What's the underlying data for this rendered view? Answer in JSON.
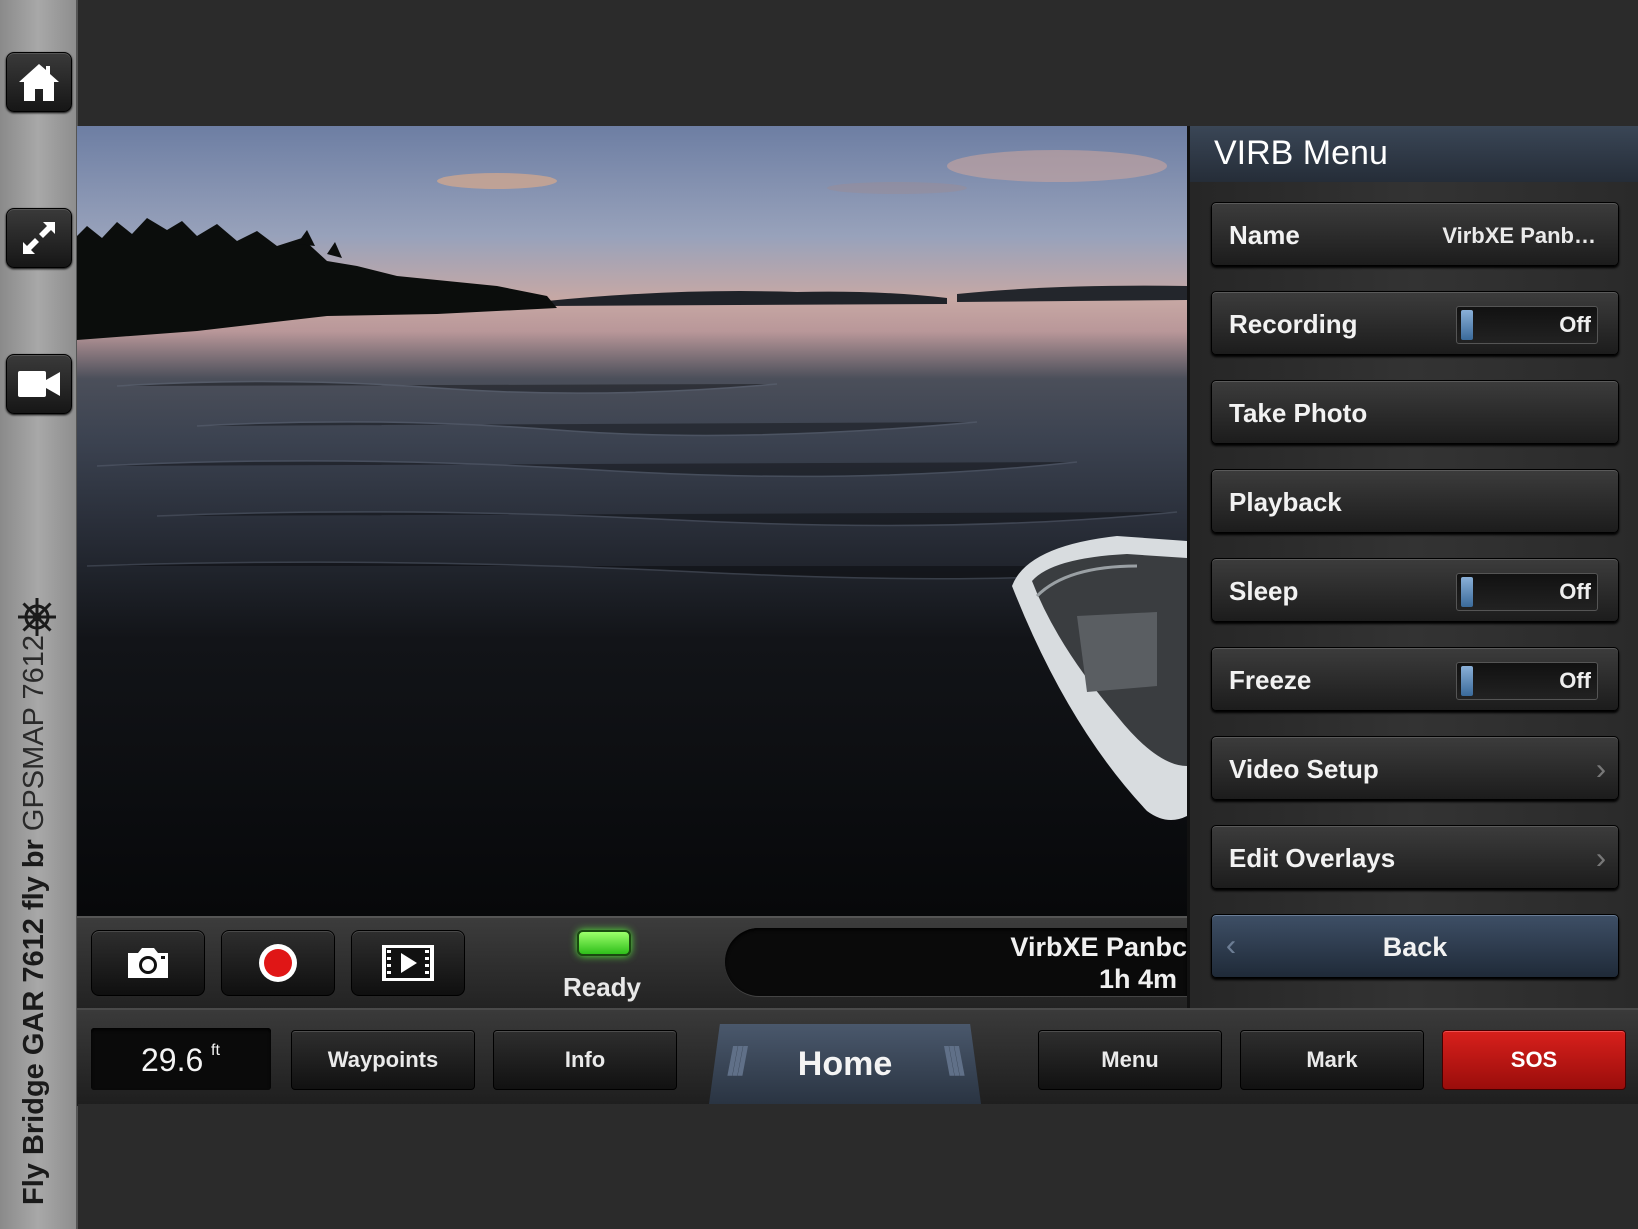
{
  "device": {
    "label_name": "Fly Bridge GAR 7612 fly br",
    "label_model": "GPSMAP 7612"
  },
  "rail": {
    "icons": [
      "home-icon",
      "fullscreen-icon",
      "video-camera-icon",
      "helm-icon"
    ]
  },
  "camera_bar": {
    "status": "Ready",
    "status_color": "#3fd22a",
    "camera_name": "VirbXE Panbc",
    "remaining_time": "1h  4m"
  },
  "virb_menu": {
    "title": "VIRB Menu",
    "name_label": "Name",
    "name_value": "VirbXE Panb…",
    "recording_label": "Recording",
    "recording_state": "Off",
    "take_photo_label": "Take Photo",
    "playback_label": "Playback",
    "sleep_label": "Sleep",
    "sleep_state": "Off",
    "freeze_label": "Freeze",
    "freeze_state": "Off",
    "video_setup_label": "Video Setup",
    "edit_overlays_label": "Edit Overlays",
    "back_label": "Back"
  },
  "bottom_nav": {
    "depth_value": "29.6",
    "depth_unit": "ft",
    "waypoints": "Waypoints",
    "info": "Info",
    "home": "Home",
    "menu": "Menu",
    "mark": "Mark",
    "sos": "SOS",
    "sos_color": "#c8140f",
    "accent_color": "#3a4656"
  }
}
